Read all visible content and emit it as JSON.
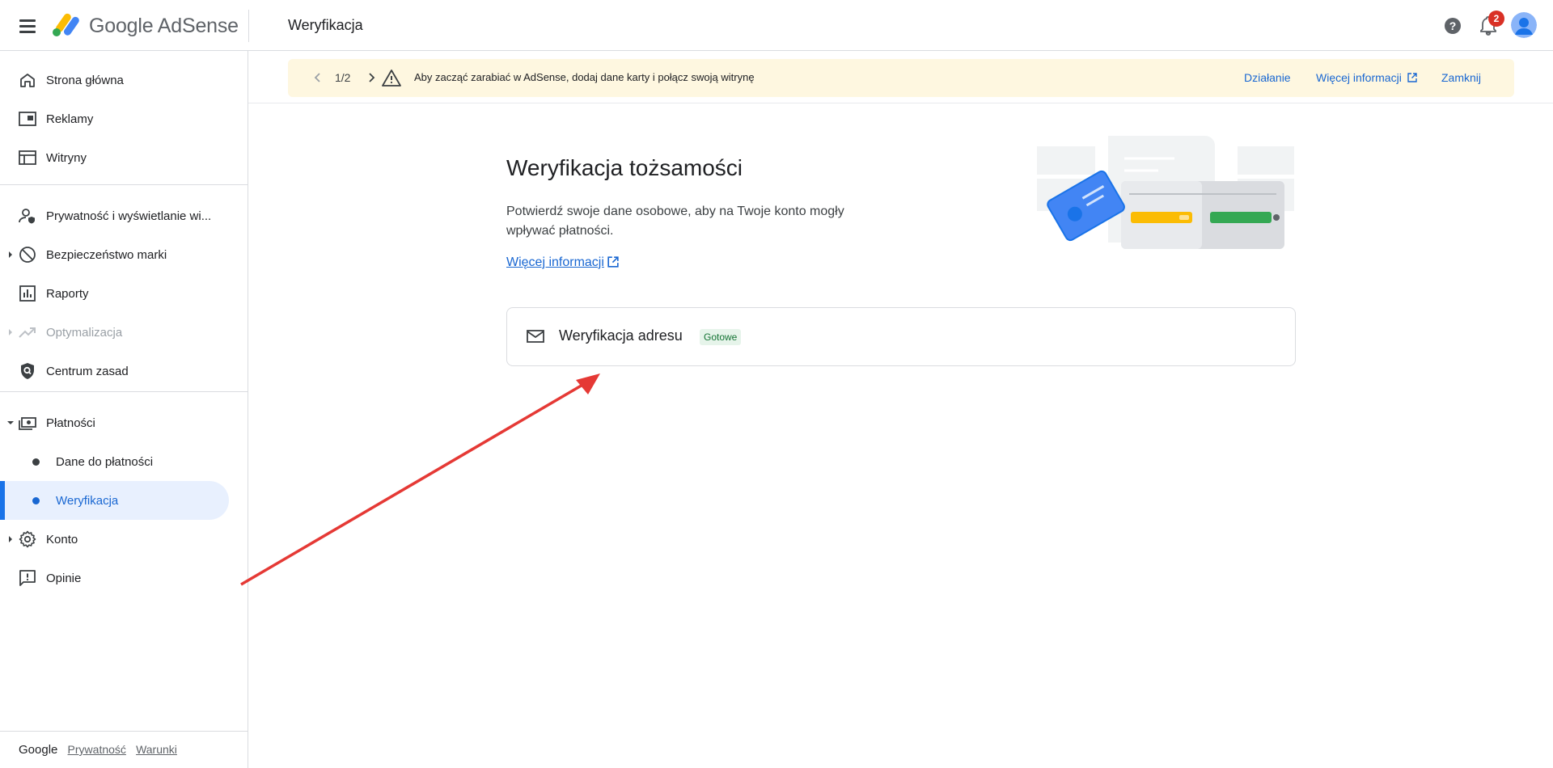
{
  "header": {
    "brand_primary": "Google",
    "brand_secondary": "AdSense",
    "page_title": "Weryfikacja",
    "notification_count": "2",
    "icons": [
      "menu-icon",
      "adsense-logo",
      "help-icon",
      "bell-icon",
      "avatar"
    ]
  },
  "sidebar": {
    "items": [
      {
        "label": "Strona główna",
        "icon": "home-icon"
      },
      {
        "label": "Reklamy",
        "icon": "ads-icon"
      },
      {
        "label": "Witryny",
        "icon": "sites-icon"
      },
      {
        "label": "Prywatność i wyświetlanie wi...",
        "icon": "privacy-icon"
      },
      {
        "label": "Bezpieczeństwo marki",
        "icon": "block-icon"
      },
      {
        "label": "Raporty",
        "icon": "reports-icon"
      },
      {
        "label": "Optymalizacja",
        "icon": "trending-icon",
        "disabled": true
      },
      {
        "label": "Centrum zasad",
        "icon": "policy-icon"
      },
      {
        "label": "Płatności",
        "icon": "payments-icon",
        "expanded": true
      },
      {
        "label": "Dane do płatności",
        "sub": true
      },
      {
        "label": "Weryfikacja",
        "sub": true,
        "active": true
      },
      {
        "label": "Konto",
        "icon": "gear-icon"
      },
      {
        "label": "Opinie",
        "icon": "feedback-icon"
      }
    ],
    "footer": {
      "brand": "Google",
      "privacy": "Prywatność",
      "terms": "Warunki"
    }
  },
  "banner": {
    "counter": "1/2",
    "message": "Aby zacząć zarabiać w AdSense, dodaj dane karty i połącz swoją witrynę",
    "action": "Działanie",
    "more_info": "Więcej informacji",
    "close": "Zamknij"
  },
  "main": {
    "title": "Weryfikacja tożsamości",
    "description": "Potwierdź swoje dane osobowe, aby na Twoje konto mogły wpływać płatności.",
    "more_link": "Więcej informacji",
    "card": {
      "title": "Weryfikacja adresu",
      "status": "Gotowe"
    }
  },
  "colors": {
    "accent": "#1a73e8",
    "banner_bg": "#fef7e0",
    "status_ok_bg": "#e6f4ea",
    "annotation_arrow": "#e53935"
  }
}
